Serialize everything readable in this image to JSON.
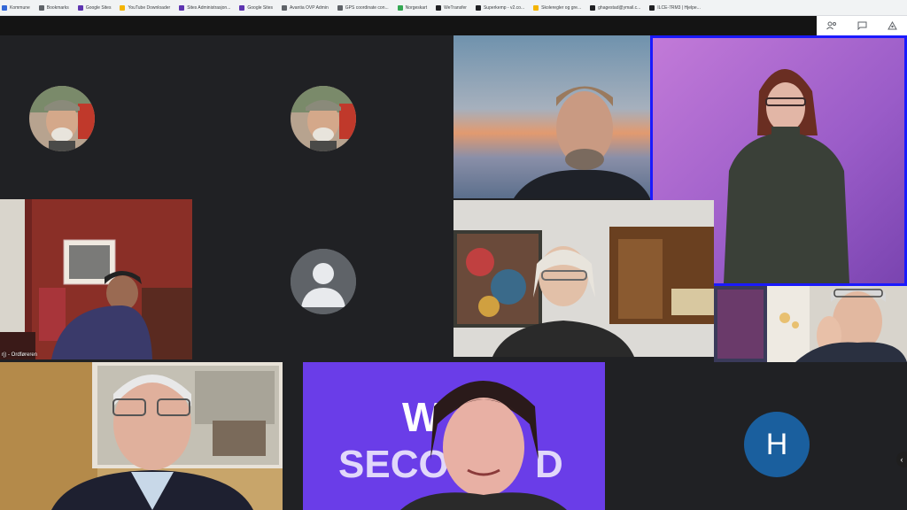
{
  "bookmarks": [
    {
      "label": "Kommune",
      "color": "#3367d6"
    },
    {
      "label": "Bookmarks",
      "color": "#5f6368"
    },
    {
      "label": "Google Sites",
      "color": "#5e35b1"
    },
    {
      "label": "YouTube Downloader",
      "color": "#f4b400"
    },
    {
      "label": "Sites Administrasjon...",
      "color": "#5e35b1"
    },
    {
      "label": "Google Sites",
      "color": "#5e35b1"
    },
    {
      "label": "Avantia OVP Admin",
      "color": "#5f6368"
    },
    {
      "label": "GPS coordinate con...",
      "color": "#5f6368"
    },
    {
      "label": "Norgeskart",
      "color": "#34a853"
    },
    {
      "label": "WeTransfer",
      "color": "#202124"
    },
    {
      "label": "Superkemp - v2.co...",
      "color": "#202124"
    },
    {
      "label": "Skoleregler og gre...",
      "color": "#f4b400"
    },
    {
      "label": "ghagestad@ymail.c...",
      "color": "#202124"
    },
    {
      "label": "ILCE-7RM3 | Hjelpe...",
      "color": "#202124"
    }
  ],
  "toolbar": {
    "people_icon": "people-icon",
    "chat_icon": "chat-icon",
    "activities_icon": "activities-icon"
  },
  "participants": {
    "tile5_label": "rj) - Ordføreren",
    "h_initial": "H",
    "banner_text": "W     SECO    D"
  },
  "colors": {
    "background": "#202124",
    "active_speaker_border": "#1a1aff",
    "h_avatar": "#1a5f9e",
    "banner_purple": "#6a3de8"
  }
}
